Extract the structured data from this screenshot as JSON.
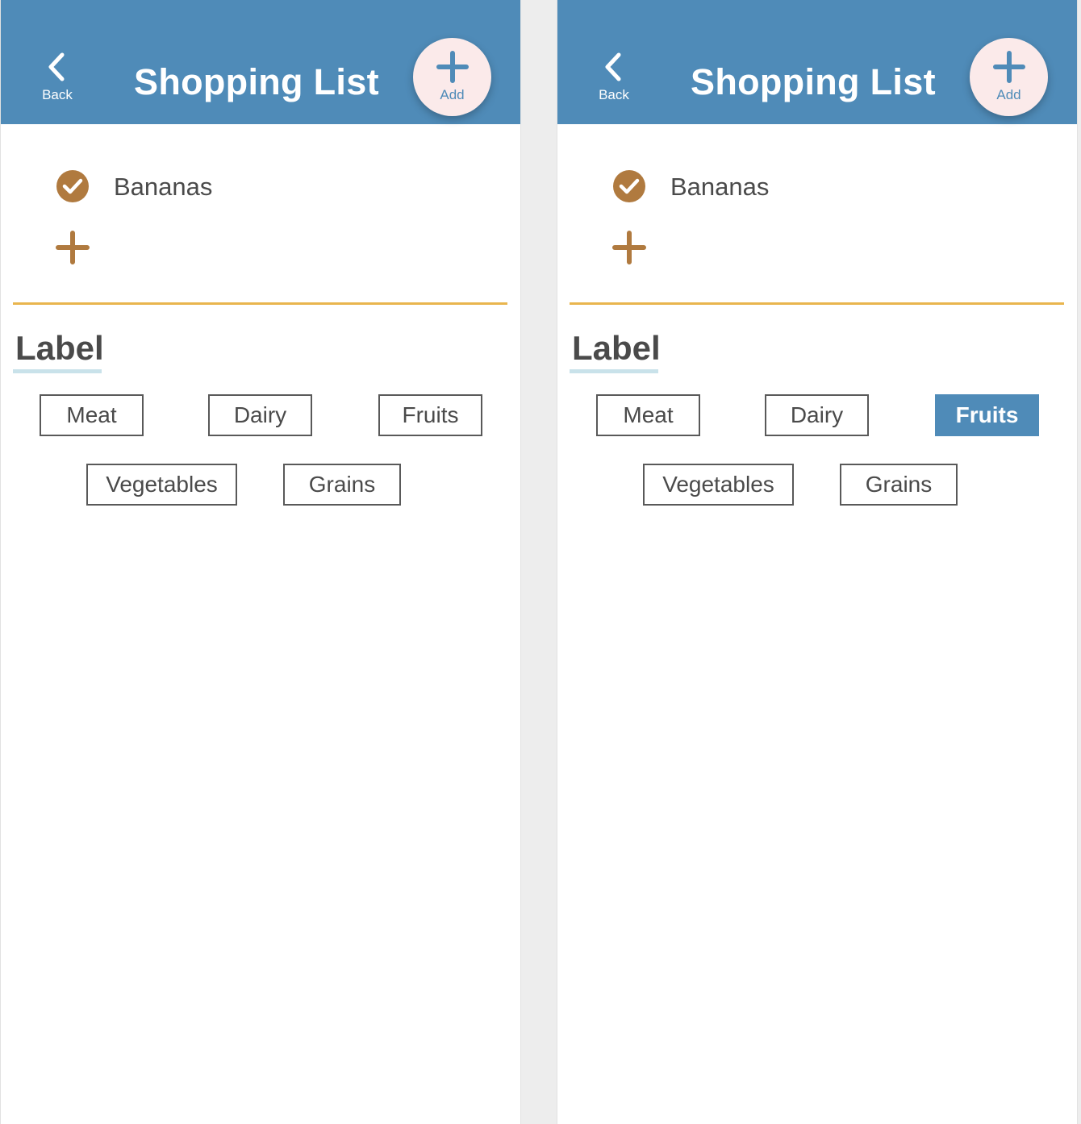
{
  "colors": {
    "header_bg": "#4f8bb8",
    "accent_brown": "#b07a3f",
    "divider": "#e9b54e",
    "fab_bg": "#fbeaea",
    "selected_chip": "#4f8bb8"
  },
  "screens": [
    {
      "header": {
        "back_label": "Back",
        "title": "Shopping List",
        "add_label": "Add"
      },
      "items": [
        {
          "name": "Bananas",
          "checked": true
        }
      ],
      "label_section": {
        "title": "Label",
        "chips": [
          "Meat",
          "Dairy",
          "Fruits",
          "Vegetables",
          "Grains"
        ],
        "selected": null
      }
    },
    {
      "header": {
        "back_label": "Back",
        "title": "Shopping List",
        "add_label": "Add"
      },
      "items": [
        {
          "name": "Bananas",
          "checked": true
        }
      ],
      "label_section": {
        "title": "Label",
        "chips": [
          "Meat",
          "Dairy",
          "Fruits",
          "Vegetables",
          "Grains"
        ],
        "selected": "Fruits"
      }
    }
  ]
}
